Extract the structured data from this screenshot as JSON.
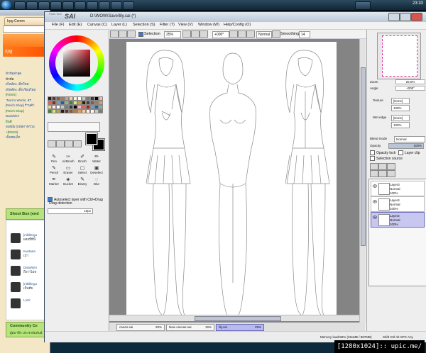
{
  "taskbar": {
    "clock": "23:33"
  },
  "browser": {
    "tab_title": "Irpg Comm",
    "banner": "Irpg",
    "links": [
      {
        "text": "หัวข้อล่าสุด",
        "style": "hi"
      },
      {
        "text": "หัวข้อ",
        "style": ""
      },
      {
        "text": "สไตล์ตะ เด็กใหม่",
        "style": "hi"
      },
      {
        "text": "",
        "style": ""
      },
      {
        "text": "สไตล์ตะ เด็กเรียนใหม่",
        "style": "hi"
      },
      {
        "text": "[RSSS]",
        "style": "gr"
      },
      {
        "text": "\"Nom's Works, สร",
        "style": "hi"
      },
      {
        "text": "[Reich Shop] ร้านค้า",
        "style": "hi"
      },
      {
        "text": "[Reich Shop]",
        "style": "gr"
      },
      {
        "text": "Darwhimi",
        "style": "hi"
      },
      {
        "text": "ยินดี",
        "style": "gr"
      },
      {
        "text": "ลงสมัย [บทสภาพรวม",
        "style": "hi"
      },
      {
        "text": "+[RSSS]",
        "style": "gr"
      },
      {
        "text": "เป็นชมเล็ก",
        "style": "hi"
      }
    ],
    "shoutbox_title": "Shout Box",
    "shoutbox_suffix": "(end",
    "shouts": [
      {
        "name": "[nikillergu",
        "msg": "ผ่อยนี้ที่นั้"
      },
      {
        "name": "Kuntana",
        "msg": "เป่า"
      },
      {
        "name": "Darwhimi",
        "msg": "ถึงว่าไม่ท"
      },
      {
        "name": "[nikillergu",
        "msg": "เป็นที่ย"
      },
      {
        "name": "LoZi:",
        "msg": ""
      }
    ],
    "community_title": "Community Ce",
    "community_sub": "ผู้สมาชิก ประชาสัมพันธ์"
  },
  "sai": {
    "logo": "SAI",
    "logo_small": "Paint Tool",
    "doc_title": "D:\\WOW\\Save\\lily.sai (*)",
    "menu": [
      "File (F)",
      "Edit (E)",
      "Canvas (C)",
      "Layer (L)",
      "Selection (S)",
      "Filter (T)",
      "View (V)",
      "Window (W)",
      "Help/Config (O)"
    ],
    "toolbar": {
      "selection_label": "Selection",
      "zoom": "25%",
      "rotation": "+000°",
      "mode": "Normal",
      "smoothing_label": "Smoothing",
      "smoothing_value": "14"
    },
    "tools": [
      {
        "label": "Pen",
        "glyph": "✎"
      },
      {
        "label": "AirBrush",
        "glyph": "✑"
      },
      {
        "label": "Brush",
        "glyph": "✐"
      },
      {
        "label": "Water",
        "glyph": "✏"
      },
      {
        "label": "Pencil",
        "glyph": "✎"
      },
      {
        "label": "Eraser",
        "glyph": "▭"
      },
      {
        "label": "Select",
        "glyph": "▢"
      },
      {
        "label": "Deselect",
        "glyph": "▣"
      },
      {
        "label": "Marker",
        "glyph": "✒"
      },
      {
        "label": "Bucket",
        "glyph": "◈"
      },
      {
        "label": "Binary",
        "glyph": "✎"
      },
      {
        "label": "Blur",
        "glyph": "◌"
      }
    ],
    "autoselect_label": "Autoselect layer with Ctrl+Drag",
    "drag_detection_label": "Drag detection",
    "drag_detection_value": "10px",
    "tabs": [
      {
        "name": "cana1.sai",
        "zoom": "25%"
      },
      {
        "name": "New canvas.sai",
        "zoom": "16%"
      },
      {
        "name": "lily.sai",
        "zoom": "25%"
      }
    ],
    "status": {
      "memory": "Memory load:59% (311MB / 867MB)",
      "keys": "Shift  Ctrl  Alt  SPC  Any"
    },
    "navigator": {
      "zoom_label": "Zoom",
      "zoom_value": "25.0%",
      "angle_label": "Angle",
      "angle_value": "+000°"
    },
    "texture_label": "Texture",
    "texture_value": "[None]",
    "texture_scale": "100%",
    "wetedge_label": "Wet edge",
    "wetedge_value": "[None]",
    "wetedge_pct": "100%",
    "blend_label": "Blend mode",
    "blend_value": "Normal",
    "opacity_label": "Opacity",
    "opacity_value": "100%",
    "opacity_level": 1.0,
    "opacity_lock_label": "Opacity lock",
    "layer_clip_label": "Layer clip",
    "selection_source_label": "Selection source",
    "layers": [
      {
        "name": "Layer3",
        "mode": "Normal",
        "opacity": "100%",
        "selected": false
      },
      {
        "name": "Layer4",
        "mode": "Normal",
        "opacity": "100%",
        "selected": false
      },
      {
        "name": "Layer2",
        "mode": "Normal",
        "opacity": "100%",
        "selected": true
      }
    ]
  },
  "watermark": "[1280x1024]:: upic.me/"
}
